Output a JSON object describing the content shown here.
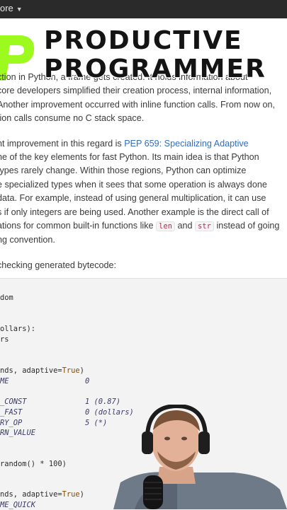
{
  "menu": {
    "label": "ore",
    "caret": "▼"
  },
  "brand": {
    "line1": "PRODUCTIVE",
    "line2": "PROGRAMMER"
  },
  "article": {
    "p1": [
      "ction in Python, a frame gets created. It holds information about",
      "core developers simplified their creation process, internal information,",
      "Another improvement occurred with inline function calls. From now on,",
      "tion calls consume no C stack space."
    ],
    "p2_first_prefix": "nt improvement in this regard is ",
    "p2_link": "PEP 659: Specializing Adaptive",
    "p2": [
      "ne of the key elements for fast Python. Its main idea is that Python",
      "types rarely change. Within those regions, Python can optimize",
      "e specialized types when it sees that some operation is always done",
      "data. For example, instead of using general multiplication, it can use",
      "s if only integers are being used. Another example is the direct call of"
    ],
    "p2_last": {
      "prefix": "ations for common built-in functions like ",
      "code1": "len",
      "mid": " and ",
      "code2": "str",
      "suffix": " instead of going"
    },
    "p2_end": "ng convention.",
    "p3": "checking generated bytecode:"
  },
  "code": {
    "l1": "dom",
    "l2": "ollars):",
    "l3": "rs",
    "l4a": "nds, adaptive=",
    "l4b": "True",
    "l4c": ")",
    "l5a": "ME",
    "l5b": "0",
    "l6a": "_CONST",
    "l6b": "1 (0.87)",
    "l7a": "_FAST",
    "l7b": "0 (dollars)",
    "l8a": "RY_OP",
    "l8b": "5 (*)",
    "l9": "RN_VALUE",
    "l10": "random() * 100)",
    "l11a": "nds, adaptive=",
    "l11b": "True",
    "l11c": ")",
    "l12": "ME_QUICK"
  },
  "colors": {
    "link": "#2f6fc4",
    "logo": "#9dfa1e",
    "codebg": "#f3f3f3"
  }
}
